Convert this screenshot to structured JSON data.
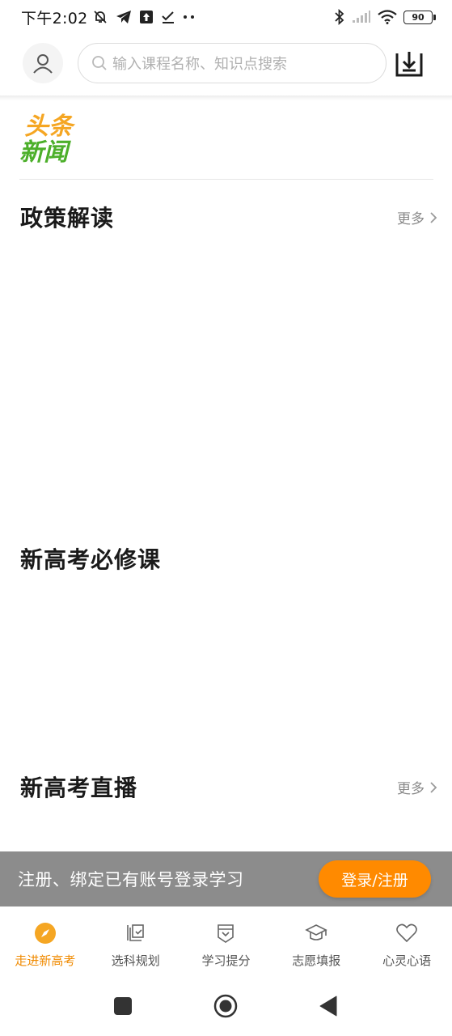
{
  "status": {
    "time": "下午2:02",
    "battery": "90"
  },
  "header": {
    "search_placeholder": "输入课程名称、知识点搜索"
  },
  "logo": {
    "line1": "头条",
    "line2": "新闻"
  },
  "sections": [
    {
      "title": "政策解读",
      "more": "更多"
    },
    {
      "title": "新高考必修课"
    },
    {
      "title": "新高考直播",
      "more": "更多"
    }
  ],
  "login_bar": {
    "text": "注册、绑定已有账号登录学习",
    "button": "登录/注册"
  },
  "tabs": [
    {
      "label": "走进新高考",
      "icon": "compass-icon",
      "active": true
    },
    {
      "label": "选科规划",
      "icon": "select-subject-icon"
    },
    {
      "label": "学习提分",
      "icon": "study-icon"
    },
    {
      "label": "志愿填报",
      "icon": "graduation-cap-icon"
    },
    {
      "label": "心灵心语",
      "icon": "heart-icon"
    }
  ],
  "colors": {
    "accent": "#ff8a00",
    "login_bar_bg": "#8c8c8c",
    "logo_orange": "#f5a623",
    "logo_green": "#4caf2a"
  }
}
